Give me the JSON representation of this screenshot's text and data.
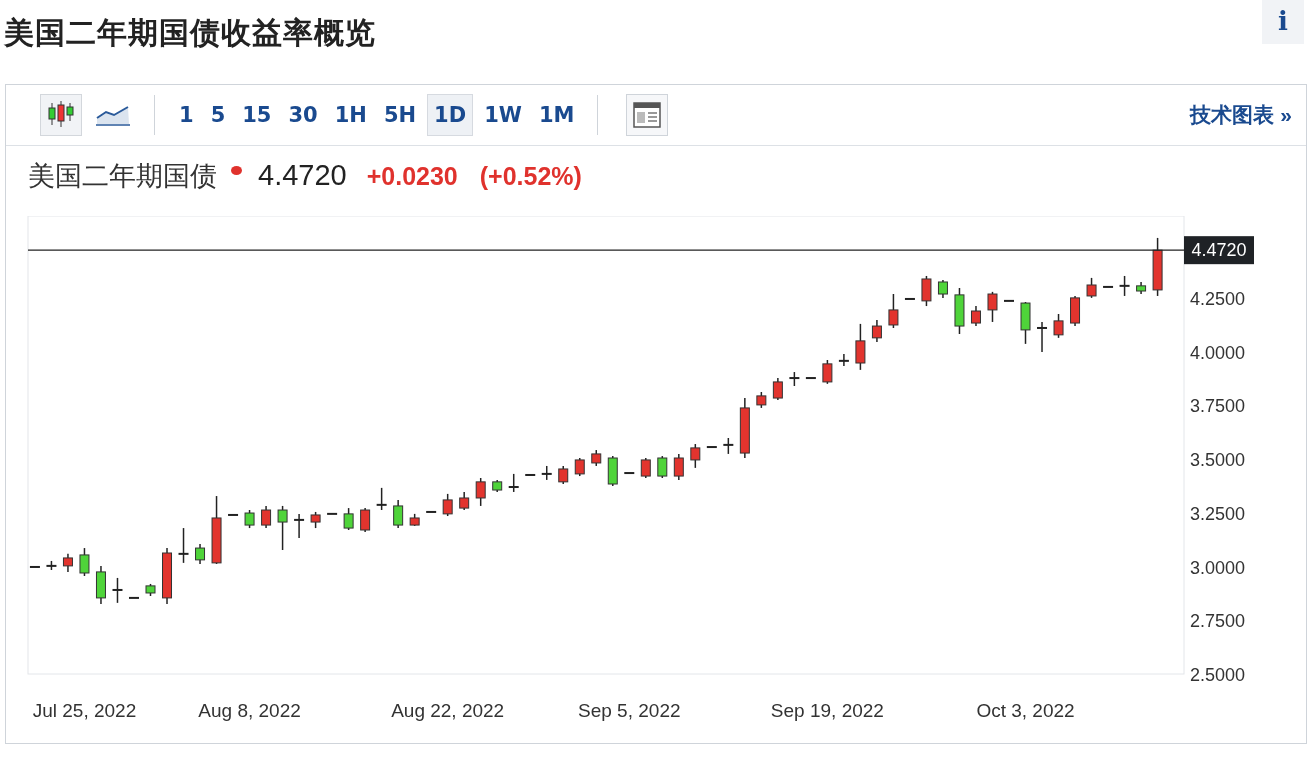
{
  "title": "美国二年期国债收益率概览",
  "info_button": "i",
  "toolbar": {
    "chart_types": [
      {
        "kind": "candles",
        "selected": true
      },
      {
        "kind": "line",
        "selected": false
      }
    ],
    "intervals": [
      {
        "label": "1",
        "selected": false
      },
      {
        "label": "5",
        "selected": false
      },
      {
        "label": "15",
        "selected": false
      },
      {
        "label": "30",
        "selected": false
      },
      {
        "label": "1H",
        "selected": false
      },
      {
        "label": "5H",
        "selected": false
      },
      {
        "label": "1D",
        "selected": true
      },
      {
        "label": "1W",
        "selected": false
      },
      {
        "label": "1M",
        "selected": false
      }
    ],
    "technical_link": "技术图表 »"
  },
  "quote": {
    "name": "美国二年期国债",
    "price": "4.4720",
    "change": "+0.0230",
    "change_percent": "(+0.52%)"
  },
  "chart": {
    "price_label": "4.4720",
    "chart_data": {
      "type": "candlestick",
      "ylim": [
        2.5,
        4.631
      ],
      "ref_lines": [
        {
          "axis": "y",
          "value": 4.472
        }
      ],
      "categories": [
        null,
        null,
        null,
        "Jul 25, 2022",
        null,
        null,
        null,
        null,
        null,
        null,
        null,
        null,
        null,
        "Aug 8, 2022",
        null,
        null,
        null,
        null,
        null,
        null,
        null,
        null,
        null,
        null,
        null,
        "Aug 22, 2022",
        null,
        null,
        null,
        null,
        null,
        null,
        null,
        null,
        null,
        null,
        "Sep 5, 2022",
        null,
        null,
        null,
        null,
        null,
        null,
        null,
        null,
        null,
        null,
        null,
        "Sep 19, 2022",
        null,
        null,
        null,
        null,
        null,
        null,
        null,
        null,
        null,
        null,
        null,
        "Oct 3, 2022",
        null,
        null,
        null,
        null,
        null,
        null,
        null,
        null
      ],
      "yticks": [
        {
          "value": 4.25,
          "label": "4.2500"
        },
        {
          "value": 4.0,
          "label": "4.0000"
        },
        {
          "value": 3.75,
          "label": "3.7500"
        },
        {
          "value": 3.5,
          "label": "3.5000"
        },
        {
          "value": 3.25,
          "label": "3.2500"
        },
        {
          "value": 3.0,
          "label": "3.0000"
        },
        {
          "value": 2.75,
          "label": "2.7500"
        },
        {
          "value": 2.5,
          "label": "2.5000"
        }
      ],
      "ohlc": [
        [
          2.998,
          2.998,
          2.998,
          2.998
        ],
        [
          3.003,
          3.026,
          2.984,
          3.003
        ],
        [
          3.003,
          3.059,
          2.975,
          3.04
        ],
        [
          3.054,
          3.086,
          2.956,
          2.97
        ],
        [
          2.975,
          3.003,
          2.826,
          2.854
        ],
        [
          2.891,
          2.947,
          2.831,
          2.891
        ],
        [
          2.854,
          2.854,
          2.854,
          2.854
        ],
        [
          2.91,
          2.919,
          2.863,
          2.877
        ],
        [
          2.854,
          3.086,
          2.826,
          3.063
        ],
        [
          3.059,
          3.179,
          3.017,
          3.059
        ],
        [
          3.086,
          3.105,
          3.012,
          3.031
        ],
        [
          3.017,
          3.328,
          3.012,
          3.226
        ],
        [
          3.24,
          3.24,
          3.24,
          3.24
        ],
        [
          3.249,
          3.263,
          3.179,
          3.193
        ],
        [
          3.193,
          3.282,
          3.179,
          3.263
        ],
        [
          3.263,
          3.282,
          3.077,
          3.207
        ],
        [
          3.217,
          3.245,
          3.133,
          3.217
        ],
        [
          3.207,
          3.254,
          3.179,
          3.24
        ],
        [
          3.245,
          3.245,
          3.245,
          3.245
        ],
        [
          3.245,
          3.272,
          3.17,
          3.179
        ],
        [
          3.17,
          3.272,
          3.161,
          3.263
        ],
        [
          3.287,
          3.366,
          3.263,
          3.287
        ],
        [
          3.282,
          3.31,
          3.179,
          3.193
        ],
        [
          3.193,
          3.245,
          3.189,
          3.226
        ],
        [
          3.254,
          3.254,
          3.254,
          3.254
        ],
        [
          3.245,
          3.338,
          3.235,
          3.31
        ],
        [
          3.272,
          3.347,
          3.263,
          3.319
        ],
        [
          3.319,
          3.412,
          3.282,
          3.394
        ],
        [
          3.394,
          3.403,
          3.347,
          3.356
        ],
        [
          3.37,
          3.431,
          3.347,
          3.37
        ],
        [
          3.426,
          3.426,
          3.426,
          3.426
        ],
        [
          3.431,
          3.468,
          3.403,
          3.431
        ],
        [
          3.394,
          3.468,
          3.384,
          3.454
        ],
        [
          3.431,
          3.505,
          3.421,
          3.496
        ],
        [
          3.482,
          3.542,
          3.468,
          3.524
        ],
        [
          3.505,
          3.514,
          3.375,
          3.384
        ],
        [
          3.435,
          3.435,
          3.435,
          3.435
        ],
        [
          3.421,
          3.505,
          3.412,
          3.496
        ],
        [
          3.505,
          3.514,
          3.412,
          3.421
        ],
        [
          3.421,
          3.524,
          3.403,
          3.505
        ],
        [
          3.496,
          3.57,
          3.459,
          3.552
        ],
        [
          3.556,
          3.556,
          3.556,
          3.556
        ],
        [
          3.566,
          3.598,
          3.524,
          3.566
        ],
        [
          3.528,
          3.784,
          3.505,
          3.738
        ],
        [
          3.752,
          3.812,
          3.738,
          3.794
        ],
        [
          3.784,
          3.877,
          3.775,
          3.859
        ],
        [
          3.877,
          3.905,
          3.84,
          3.877
        ],
        [
          3.877,
          3.877,
          3.877,
          3.877
        ],
        [
          3.859,
          3.961,
          3.85,
          3.943
        ],
        [
          3.957,
          3.989,
          3.933,
          3.957
        ],
        [
          3.947,
          4.129,
          3.915,
          4.05
        ],
        [
          4.064,
          4.147,
          4.045,
          4.119
        ],
        [
          4.124,
          4.268,
          4.11,
          4.194
        ],
        [
          4.245,
          4.245,
          4.245,
          4.245
        ],
        [
          4.236,
          4.352,
          4.212,
          4.338
        ],
        [
          4.324,
          4.333,
          4.25,
          4.268
        ],
        [
          4.264,
          4.296,
          4.082,
          4.119
        ],
        [
          4.133,
          4.212,
          4.119,
          4.189
        ],
        [
          4.194,
          4.278,
          4.138,
          4.268
        ],
        [
          4.236,
          4.236,
          4.236,
          4.236
        ],
        [
          4.226,
          4.231,
          4.036,
          4.101
        ],
        [
          4.11,
          4.138,
          3.998,
          4.11
        ],
        [
          4.078,
          4.175,
          4.064,
          4.143
        ],
        [
          4.133,
          4.259,
          4.119,
          4.25
        ],
        [
          4.259,
          4.343,
          4.25,
          4.31
        ],
        [
          4.301,
          4.301,
          4.301,
          4.301
        ],
        [
          4.306,
          4.352,
          4.259,
          4.306
        ],
        [
          4.306,
          4.324,
          4.268,
          4.282
        ],
        [
          4.287,
          4.529,
          4.259,
          4.472
        ]
      ]
    }
  }
}
